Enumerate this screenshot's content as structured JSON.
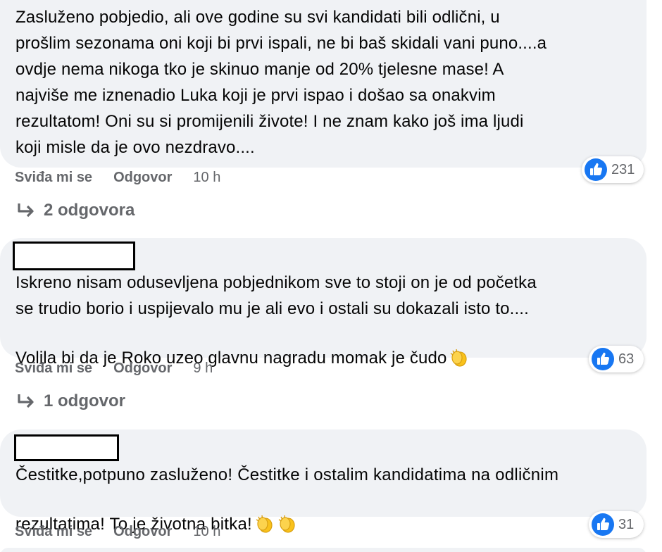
{
  "comments": [
    {
      "text": "Zasluženo pobjedio, ali ove godine su svi kandidati bili odlični, u\nprošlim sezonama oni koji bi prvi ispali, ne bi baš skidali vani puno....a\novdje nema nikoga tko je skinuo manje od 20% tjelesne mase! A\nnajviše me iznenadio Luka koji je prvi ispao i došao sa onakvim\nrezultatom! Oni su si promijenili živote! I ne znam kako još ima ljudi\nkoji misle da je ovo nezdravo....",
      "like_label": "Sviđa mi se",
      "reply_label": "Odgovor",
      "time": "10 h",
      "replies_label": "2 odgovora",
      "reaction_count": "231"
    },
    {
      "text": "Iskreno nisam odusevljena pobjednikom sve to stoji on je od početka\nse trudio borio i uspijevalo mu je ali evo i ostali su dokazali isto to....\nVolila bi da je Roko uzeo glavnu nagradu momak je čudo",
      "like_label": "Sviđa mi se",
      "reply_label": "Odgovor",
      "time": "9 h",
      "replies_label": "1 odgovor",
      "reaction_count": "63"
    },
    {
      "text": "Čestitke,potpuno zasluženo! Čestitke i ostalim kandidatima na odličnim\nrezultatima! To je životna bitka!",
      "like_label": "Sviđa mi se",
      "reply_label": "Odgovor",
      "time": "10 h",
      "reaction_count": "31"
    }
  ],
  "icons": {
    "like": "like-thumb-icon",
    "clap": "clapping-hands-emoji",
    "reply_arrow": "reply-arrow-icon"
  },
  "colors": {
    "bubble_bg": "#f0f2f5",
    "secondary_text": "#65676b",
    "like_blue": "#1877f2",
    "clap_yellow": "#f9c21b"
  }
}
